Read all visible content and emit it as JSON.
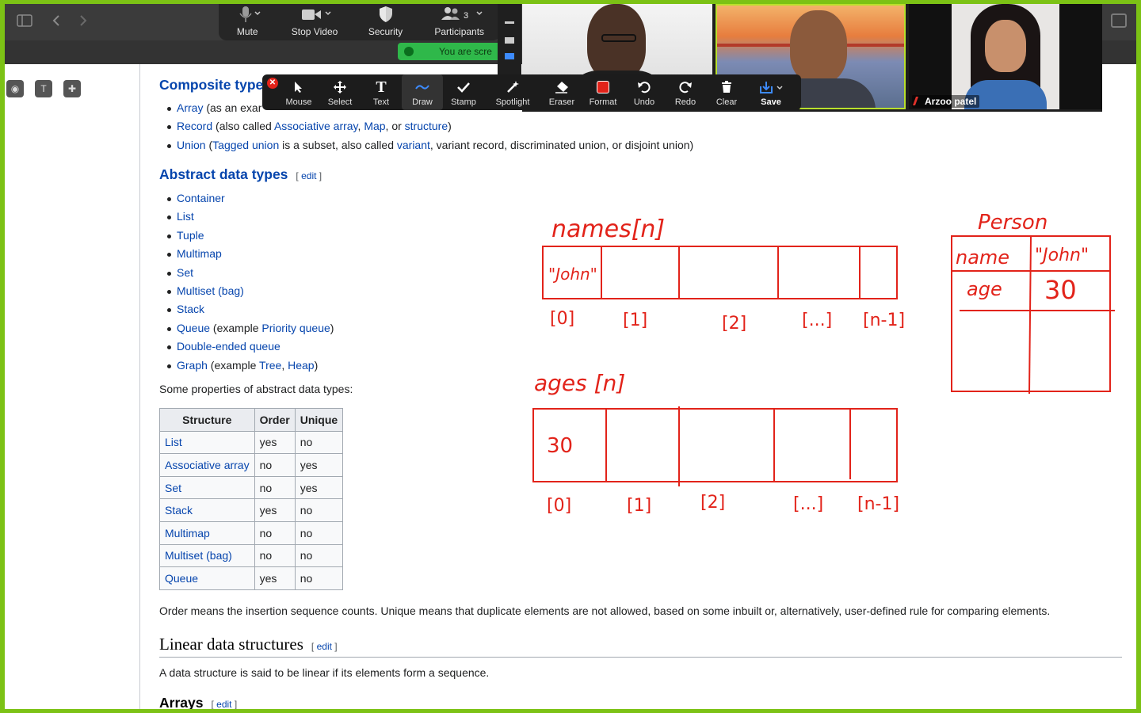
{
  "zoom_controls": [
    {
      "label": "Mute",
      "icon": "mic-icon"
    },
    {
      "label": "Stop Video",
      "icon": "video-camera-icon"
    },
    {
      "label": "Security",
      "icon": "shield-icon"
    },
    {
      "label": "Participants",
      "icon": "participants-icon",
      "count": "3"
    }
  ],
  "share_status": "You are scre",
  "participants": [
    {
      "name": ""
    },
    {
      "name": ""
    },
    {
      "name": "Arzoo patel",
      "muted": true
    }
  ],
  "annotation_tools": [
    {
      "label": "Mouse",
      "icon": "cursor-icon"
    },
    {
      "label": "Select",
      "icon": "move-icon"
    },
    {
      "label": "Text",
      "icon": "text-icon"
    },
    {
      "label": "Draw",
      "icon": "draw-wave-icon",
      "active": true
    },
    {
      "label": "Stamp",
      "icon": "checkmark-icon"
    },
    {
      "label": "Spotlight",
      "icon": "spotlight-icon"
    },
    {
      "label": "Eraser",
      "icon": "eraser-icon"
    },
    {
      "label": "Format",
      "icon": "format-color-icon",
      "color": "#e2231a"
    },
    {
      "label": "Undo",
      "icon": "undo-icon"
    },
    {
      "label": "Redo",
      "icon": "redo-icon"
    },
    {
      "label": "Clear",
      "icon": "trash-icon"
    },
    {
      "label": "Save",
      "icon": "save-icon"
    }
  ],
  "article": {
    "composite_heading": "Composite type",
    "composite_items": {
      "array": {
        "link": "Array",
        "rest": "(as an exar"
      },
      "record": {
        "link": "Record",
        "t1": "(also called ",
        "l2": "Associative array",
        "t2": ", ",
        "l3": "Map",
        "t3": ", or ",
        "l4": "structure",
        "t4": ")"
      },
      "union": {
        "link": "Union",
        "t1": "(",
        "l2": "Tagged union",
        "t2": " is a subset, also called ",
        "l3": "variant",
        "t3": ", variant record, discriminated union, or disjoint union)"
      }
    },
    "abstract_heading": "Abstract data types",
    "edit": "edit",
    "abstract_items": [
      "Container",
      "List",
      "Tuple",
      "Multimap",
      "Set",
      "Multiset (bag)",
      "Stack"
    ],
    "queue_item": {
      "link": "Queue",
      "t1": " (example ",
      "l2": "Priority queue",
      "t2": ")"
    },
    "deque_item": "Double-ended queue",
    "graph_item": {
      "link": "Graph",
      "t1": " (example ",
      "l2": "Tree",
      "t2": ", ",
      "l3": "Heap",
      "t3": ")"
    },
    "props_intro": "Some properties of abstract data types:",
    "table": {
      "headers": [
        "Structure",
        "Order",
        "Unique"
      ],
      "rows": [
        [
          "List",
          "yes",
          "no"
        ],
        [
          "Associative array",
          "no",
          "yes"
        ],
        [
          "Set",
          "no",
          "yes"
        ],
        [
          "Stack",
          "yes",
          "no"
        ],
        [
          "Multimap",
          "no",
          "no"
        ],
        [
          "Multiset (bag)",
          "no",
          "no"
        ],
        [
          "Queue",
          "yes",
          "no"
        ]
      ]
    },
    "order_note": "Order means the insertion sequence counts. Unique means that duplicate elements are not allowed, based on some inbuilt or, alternatively, user-defined rule for comparing elements.",
    "linear_heading": "Linear data structures",
    "linear_text": "A data structure is said to be linear if its elements form a sequence.",
    "arrays_heading": "Arrays"
  },
  "annotations": {
    "ink_color": "#e2231a",
    "names_label": "names[n]",
    "names_first": "\"John\"",
    "names_indices": [
      "[0]",
      "[1]",
      "[2]",
      "[...]",
      "[n-1]"
    ],
    "ages_label": "ages [n]",
    "ages_first": "30",
    "ages_indices": [
      "[0]",
      "[1]",
      "[2]",
      "[...]",
      "[n-1]"
    ],
    "person_label": "Person",
    "person_rows": [
      [
        "name",
        "\"John\""
      ],
      [
        "age",
        "30"
      ]
    ]
  }
}
